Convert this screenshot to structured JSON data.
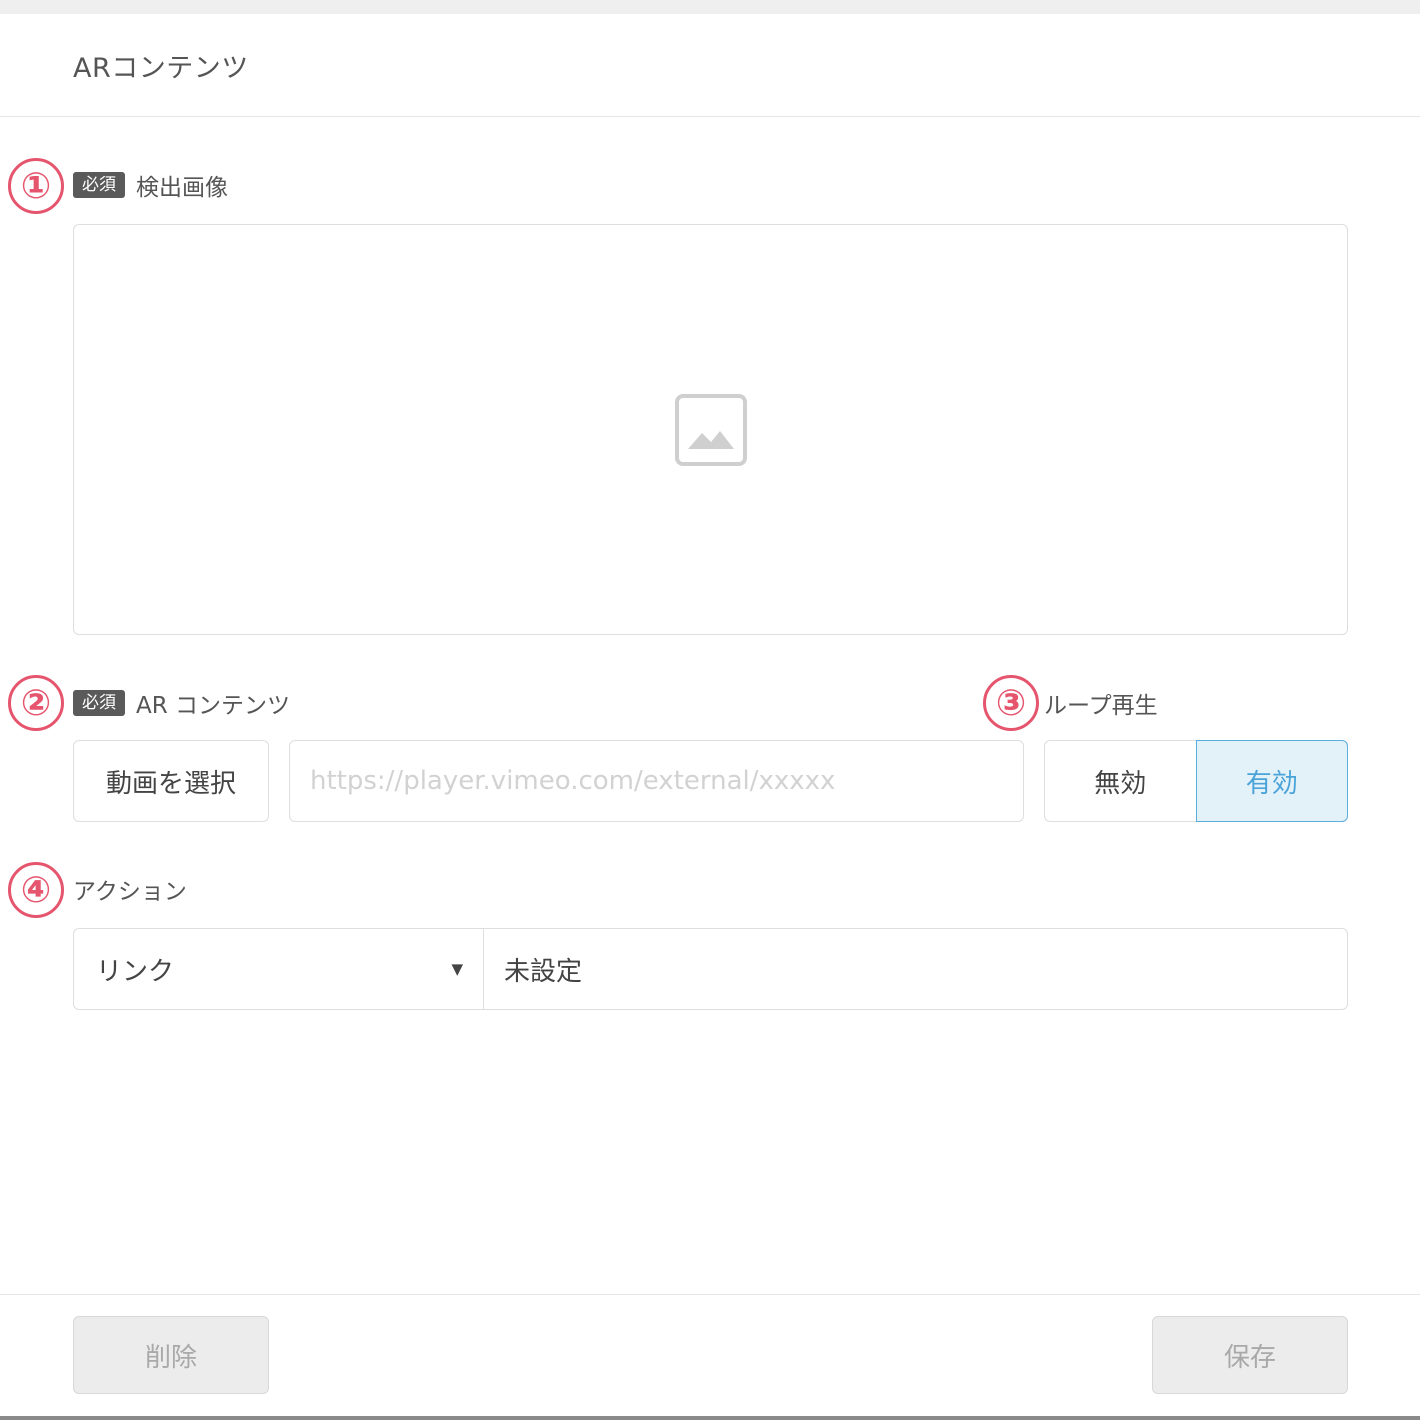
{
  "header": {
    "title": "ARコンテンツ"
  },
  "markers": [
    "①",
    "②",
    "③",
    "④"
  ],
  "detect_image": {
    "required_badge": "必須",
    "label": "検出画像",
    "icon": "image-placeholder-icon"
  },
  "ar_content": {
    "required_badge": "必須",
    "label": "AR コンテンツ",
    "select_video_label": "動画を選択",
    "url_placeholder": "https://player.vimeo.com/external/xxxxx",
    "url_value": ""
  },
  "loop": {
    "label": "ループ再生",
    "options": [
      "無効",
      "有効"
    ],
    "selected": "有効"
  },
  "action": {
    "label": "アクション",
    "selected_type": "リンク",
    "value": "未設定"
  },
  "footer": {
    "delete_label": "削除",
    "save_label": "保存"
  },
  "colors": {
    "marker": "#e5556d",
    "toggle_active_bg": "#e3f1f8",
    "toggle_active_border": "#5aaede",
    "toggle_active_text": "#4aa3d8",
    "badge_bg": "#5a5a5a"
  }
}
